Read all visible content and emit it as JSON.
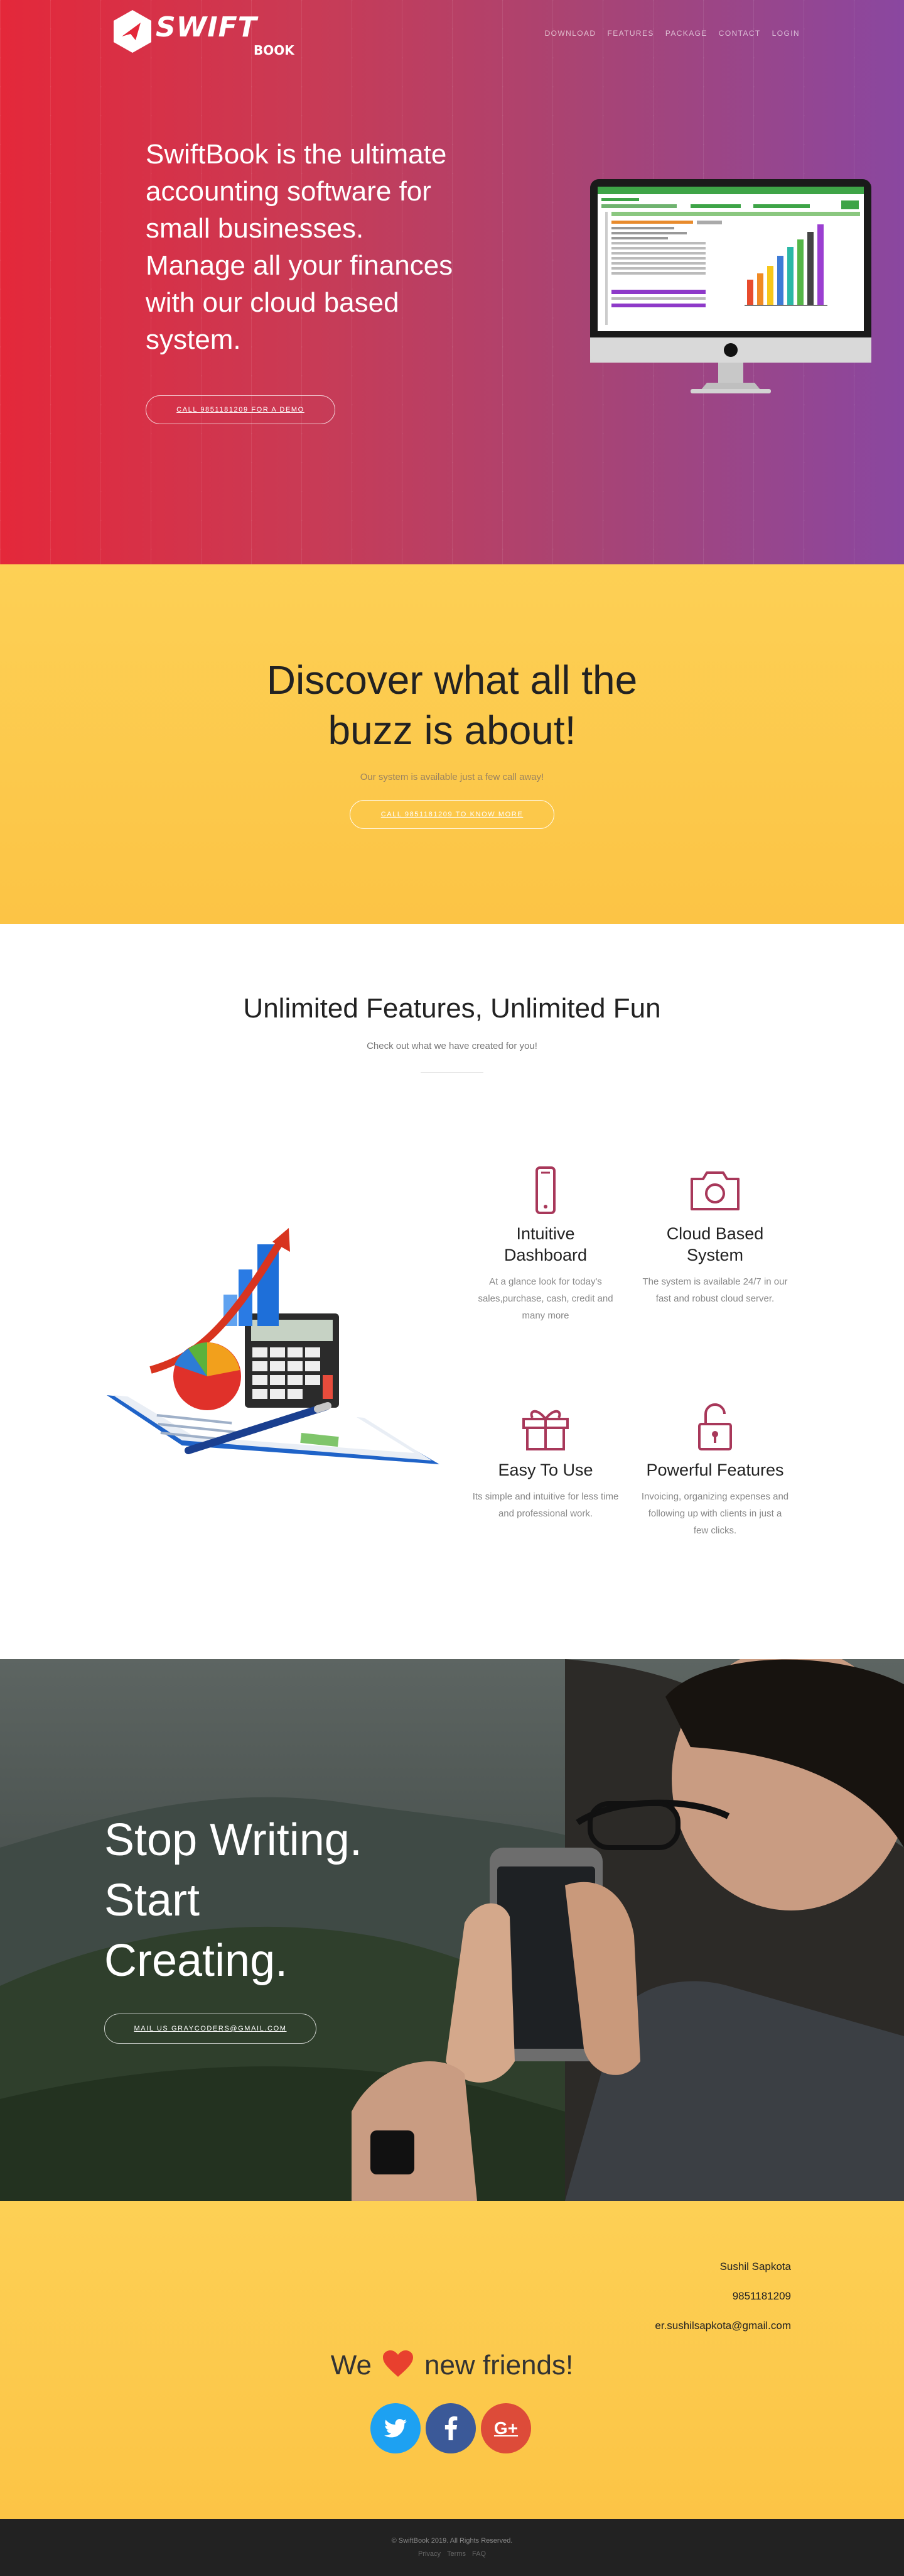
{
  "header": {
    "logo_text": "SWIFT",
    "logo_sub": "BOOK",
    "nav": [
      {
        "label": "DOWNLOAD"
      },
      {
        "label": "FEATURES"
      },
      {
        "label": "PACKAGE"
      },
      {
        "label": "CONTACT"
      },
      {
        "label": "LOGIN"
      }
    ]
  },
  "hero": {
    "title": "SwiftBook is the ultimate accounting software for small businesses. Manage all your finances with our cloud based system.",
    "cta": "CALL 9851181209 FOR A DEMO"
  },
  "buzz": {
    "title_line1": "Discover what all the",
    "title_line2": "buzz is about!",
    "subtitle": "Our system is available just a few call away!",
    "cta": "CALL 9851181209 TO KNOW MORE"
  },
  "features": {
    "title": "Unlimited Features, Unlimited Fun",
    "subtitle": "Check out what we have created for you!",
    "items": [
      {
        "icon": "smartphone-icon",
        "title_line1": "Intuitive",
        "title_line2": "Dashboard",
        "text": "At a glance look for today's sales,purchase, cash, credit and many more"
      },
      {
        "icon": "camera-icon",
        "title_line1": "Cloud Based",
        "title_line2": "System",
        "text": "The system is available 24/7 in our fast and robust cloud server."
      },
      {
        "icon": "gift-icon",
        "title_line1": "Easy To Use",
        "title_line2": "",
        "text": "Its simple and intuitive for less time and professional work."
      },
      {
        "icon": "lock-icon",
        "title_line1": "Powerful Features",
        "title_line2": "",
        "text": "Invoicing, organizing expenses and following up with clients in just a few clicks."
      }
    ]
  },
  "promo": {
    "line1": "Stop Writing.",
    "line2": "Start",
    "line3": "Creating.",
    "cta": "MAIL US GRAYCODERS@GMAIL.COM"
  },
  "contact": {
    "name": "Sushil Sapkota",
    "phone": "9851181209",
    "email": "er.sushilsapkota@gmail.com",
    "love_prefix": "We",
    "love_suffix": "new friends!",
    "socials": [
      {
        "icon": "twitter-icon",
        "label": "t"
      },
      {
        "icon": "facebook-icon",
        "label": "f"
      },
      {
        "icon": "google-plus-icon",
        "label": "G+"
      }
    ]
  },
  "footer": {
    "copyright": "© SwiftBook 2019. All Rights Reserved.",
    "links": [
      {
        "label": "Privacy"
      },
      {
        "label": "Terms"
      },
      {
        "label": "FAQ"
      }
    ]
  },
  "colors": {
    "accent": "#a8385a",
    "yellow": "#fdc84c",
    "twitter": "#1da1f2",
    "facebook": "#3b5998",
    "google": "#dd4b39"
  }
}
